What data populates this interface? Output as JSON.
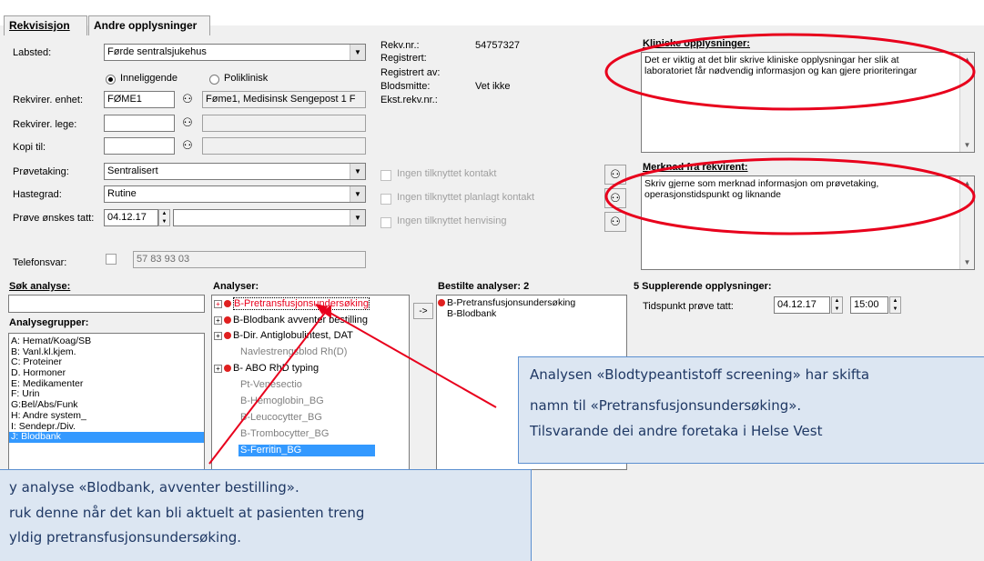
{
  "tabs": [
    {
      "label": "Rekvisisjon"
    },
    {
      "label": "Andre opplysninger"
    }
  ],
  "form": {
    "labsted_label": "Labsted:",
    "labsted_value": "Førde sentralsjukehus",
    "radio_inneliggende": "Inneliggende",
    "radio_poliklinisk": "Poliklinisk",
    "rekv_enhet_label": "Rekvirer. enhet:",
    "rekv_enhet_code": "FØME1",
    "rekv_enhet_name": "Føme1, Medisinsk Sengepost 1 F",
    "rekv_lege_label": "Rekvirer. lege:",
    "kopi_label": "Kopi til:",
    "provetaking_label": "Prøvetaking:",
    "provetaking_value": "Sentralisert",
    "hastegrad_label": "Hastegrad:",
    "hastegrad_value": "Rutine",
    "prove_onskes_label": "Prøve ønskes tatt:",
    "prove_onskes_date": "04.12.17",
    "telefonsvar_label": "Telefonsvar:",
    "telefonsvar_value": "57 83 93 03"
  },
  "rekv_info": {
    "rekv_nr_label": "Rekv.nr.:",
    "rekv_nr_value": "54757327",
    "registrert_label": "Registrert:",
    "registrert_av_label": "Registrert av:",
    "blodsmitte_label": "Blodsmitte:",
    "blodsmitte_value": "Vet ikke",
    "ekst_rekv_label": "Ekst.rekv.nr.:"
  },
  "contact_options": [
    {
      "label": "Ingen tilknyttet kontakt"
    },
    {
      "label": "Ingen tilknyttet planlagt kontakt"
    },
    {
      "label": "Ingen tilknyttet henvising"
    }
  ],
  "kliniske": {
    "title": "Kliniske opplysninger:",
    "text_line1": "Det er viktig at det blir skrive kliniske opplysningar her slik at",
    "text_line2": "laboratoriet får nødvendig informasjon og kan gjere prioriteringar"
  },
  "merknad": {
    "title": "Merknad fra rekvirent:",
    "text_line1": "Skriv gjerne som merknad informasjon om prøvetaking,",
    "text_line2": "operasjonstidspunkt og liknande"
  },
  "sok": {
    "label": "Søk analyse:",
    "groups_label": "Analysegrupper:",
    "groups": [
      {
        "label": "A: Hemat/Koag/SB"
      },
      {
        "label": "B: Vanl.kl.kjem."
      },
      {
        "label": "C: Proteiner"
      },
      {
        "label": "D. Hormoner"
      },
      {
        "label": "E: Medikamenter"
      },
      {
        "label": "F: Urin"
      },
      {
        "label": "G:Bel/Abs/Funk"
      },
      {
        "label": "H: Andre system_"
      },
      {
        "label": "I: Sendepr./Div."
      },
      {
        "label": "J: Blodbank"
      }
    ]
  },
  "analyser": {
    "label": "Analyser:",
    "items": [
      {
        "label": "B-Pretransfusjonsundersøking"
      },
      {
        "label": "B-Blodbank avventer bestilling"
      },
      {
        "label": "B-Dir. Antiglobulintest, DAT"
      },
      {
        "label": "Navlestrengsblod Rh(D)"
      },
      {
        "label": "B- ABO RhD typing"
      },
      {
        "label": "Pt-Venesectio"
      },
      {
        "label": "B-Hemoglobin_BG"
      },
      {
        "label": "B-Leucocytter_BG"
      },
      {
        "label": "B-Trombocytter_BG"
      },
      {
        "label": "S-Ferritin_BG"
      }
    ]
  },
  "bestilte": {
    "label": "Bestilte analyser: 2",
    "items": [
      {
        "label": "B-Pretransfusjonsundersøking"
      },
      {
        "label": "B-Blodbank"
      }
    ]
  },
  "arrow_button": "->",
  "supplerende": {
    "label": "5 Supplerende opplysninger:",
    "tidspunkt_label": "Tidspunkt prøve tatt:",
    "date": "04.12.17",
    "time": "15:00"
  },
  "callouts": {
    "right_line1": "Analysen «Blodtypeantistoff screening» har skifta",
    "right_line2": "namn til «Pretransfusjonsundersøking».",
    "right_line3": "Tilsvarande  dei andre foretaka i Helse Vest",
    "left_line1": "y analyse «Blodbank, avventer bestilling».",
    "left_line2": "ruk denne når det kan bli aktuelt at pasienten treng",
    "left_line3": "yldig pretransfusjonsundersøking."
  },
  "colors": {
    "highlight_red": "#e8001c",
    "selection_blue": "#3399ff",
    "callout_bg": "#dce6f2",
    "callout_text": "#1f3864"
  }
}
